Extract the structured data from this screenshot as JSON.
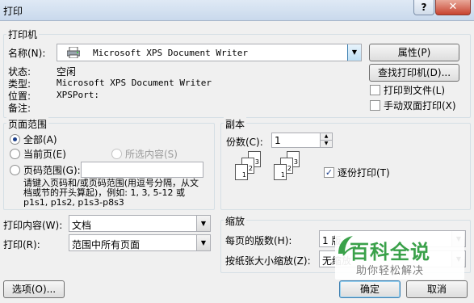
{
  "window": {
    "title": "打印",
    "help_label": "?",
    "close_label": "✕"
  },
  "printer": {
    "group_title": "打印机",
    "name_label": "名称(N):",
    "name_value": "Microsoft XPS Document Writer",
    "status_label": "状态:",
    "status_value": "空闲",
    "type_label": "类型:",
    "type_value": "Microsoft XPS Document Writer",
    "where_label": "位置:",
    "where_value": "XPSPort:",
    "comment_label": "备注:",
    "properties_button": "属性(P)",
    "find_printer_button": "查找打印机(D)...",
    "print_to_file_label": "打印到文件(L)",
    "manual_duplex_label": "手动双面打印(X)"
  },
  "page_range": {
    "group_title": "页面范围",
    "all_label": "全部(A)",
    "current_label": "当前页(E)",
    "selection_label": "所选内容(S)",
    "pages_label": "页码范围(G):",
    "pages_value": "",
    "hint": "请键入页码和/或页码范围(用逗号分隔，从文档或节的开头算起)，例如: 1, 3, 5-12 或 p1s1, p1s2, p1s3-p8s3"
  },
  "copies": {
    "group_title": "副本",
    "count_label": "份数(C):",
    "count_value": "1",
    "collate_label": "逐份打印(T)",
    "collate_checked": true
  },
  "print_what": {
    "label": "打印内容(W):",
    "value": "文档"
  },
  "print_option": {
    "label": "打印(R):",
    "value": "范围中所有页面"
  },
  "zoom": {
    "group_title": "缩放",
    "pages_per_sheet_label": "每页的版数(H):",
    "pages_per_sheet_value": "1 版",
    "scale_label": "按纸张大小缩放(Z):",
    "scale_value": "无缩放"
  },
  "footer": {
    "options_button": "选项(O)...",
    "ok_button": "确定",
    "cancel_button": "取消"
  },
  "watermark": {
    "brand": "百科全说",
    "tagline": "助你轻松解决"
  }
}
